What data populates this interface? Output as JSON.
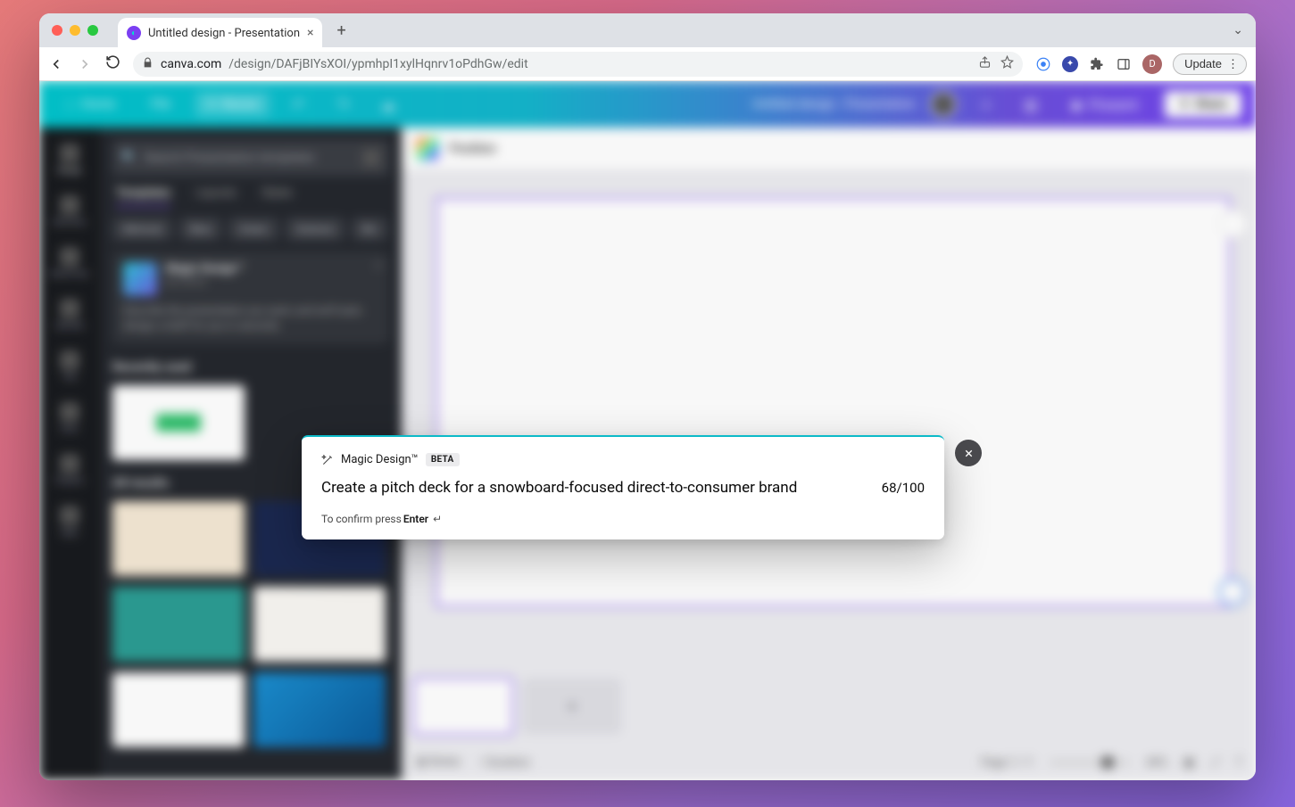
{
  "browser": {
    "tab_title": "Untitled design - Presentation",
    "url_host": "canva.com",
    "url_path": "/design/DAFjBIYsXOI/ypmhpI1xylHqnrv1oPdhGw/edit",
    "update_button": "Update",
    "profile_initial": "D"
  },
  "header": {
    "home": "Home",
    "file": "File",
    "resize": "Resize",
    "title": "Untitled design - Presentation",
    "present": "Present",
    "share": "Share"
  },
  "rail": {
    "items": [
      {
        "label": "Design"
      },
      {
        "label": "Elements"
      },
      {
        "label": "Brand Hub"
      },
      {
        "label": "Uploads"
      },
      {
        "label": "Text"
      },
      {
        "label": "Draw"
      },
      {
        "label": "Projects"
      },
      {
        "label": "Apps"
      }
    ]
  },
  "panel": {
    "search_placeholder": "Search Presentation templates",
    "tabs": {
      "templates": "Templates",
      "layouts": "Layouts",
      "styles": "Styles"
    },
    "chips": [
      "Minimal",
      "Blue",
      "Green",
      "Science",
      "Biz"
    ],
    "magic": {
      "title": "Magic Design™",
      "by": "by Canva",
      "desc": "Describe the presentation you want, and we'll auto-design a draft for you in seconds."
    },
    "recent_title": "Recently used",
    "results_title": "All results"
  },
  "canvas": {
    "toolbar_label": "Position",
    "notes": "Notes",
    "duration": "Duration",
    "page_label": "Page 1 / 1",
    "zoom": "44%"
  },
  "modal": {
    "title": "Magic Design™",
    "beta": "BETA",
    "prompt_value": "Create a pitch deck for a snowboard-focused direct-to-consumer brand",
    "counter": "68/100",
    "hint_prefix": "To confirm press ",
    "hint_key": "Enter"
  }
}
